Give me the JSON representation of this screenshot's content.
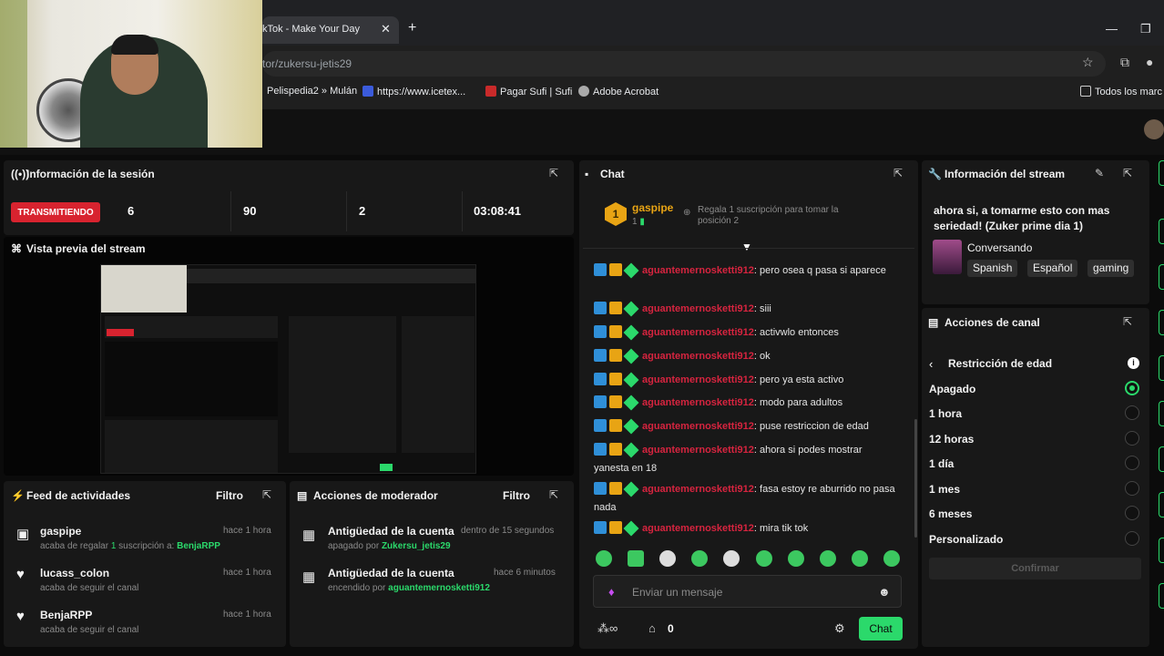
{
  "browser": {
    "tab_title": "kTok - Make Your Day",
    "tab_close": "✕",
    "new_tab": "+",
    "address": "tor/zukersu-jetis29",
    "bookmarks": [
      "Pelispedia2 » Mulán",
      "https://www.icetex...",
      "Pagar Sufi | Sufi",
      "Adobe Acrobat",
      "Todos los marc"
    ],
    "minimize": "—",
    "restore": "❐"
  },
  "session": {
    "title": "Información de la sesión",
    "status": "TRANSMITIENDO",
    "stats": [
      "6",
      "90",
      "2",
      "03:08:41"
    ]
  },
  "preview": {
    "title": "Vista previa del stream"
  },
  "feed": {
    "title": "Feed de actividades",
    "filter": "Filtro",
    "items": [
      {
        "name": "gaspipe",
        "time": "hace 1 hora",
        "sub_pre": "acaba de regalar ",
        "sub_count": "1",
        "sub_mid": " suscripción a: ",
        "sub_user": "BenjaRPP"
      },
      {
        "name": "lucass_colon",
        "time": "hace 1 hora",
        "sub": "acaba de seguir el canal"
      },
      {
        "name": "BenjaRPP",
        "time": "hace 1 hora",
        "sub": "acaba de seguir el canal"
      }
    ]
  },
  "mod": {
    "title": "Acciones de moderador",
    "filter": "Filtro",
    "items": [
      {
        "action": "Antigüedad de la cuenta",
        "time": "dentro de 15 segundos",
        "sub": "apagado por ",
        "user": "Zukersu_jetis29"
      },
      {
        "action": "Antigüedad de la cuenta",
        "time": "hace 6 minutos",
        "sub": "encendido por ",
        "user": "aguantemernosketti912"
      }
    ]
  },
  "chat": {
    "title": "Chat",
    "top_gifter": {
      "name": "gaspipe",
      "rank": "1",
      "count": "1",
      "note": "Regala 1 suscripción para tomar la posición 2"
    },
    "username": "aguantemernosketti912",
    "messages": [
      "pero osea q pasa si aparece",
      "siii",
      "activwlo entonces",
      "ok",
      "pero ya esta activo",
      "modo para adultos",
      "puse restriccion de edad",
      "ahora si podes mostrar yanesta en 18",
      "fasa estoy re aburrido no pasa nada",
      "mira tik tok"
    ],
    "input_placeholder": "Enviar un mensaje",
    "gifts_count": "0",
    "send_label": "Chat"
  },
  "stream_info": {
    "title": "Información del stream",
    "description": "ahora si, a tomarme esto con mas seriedad! (Zuker prime dia 1)",
    "category": "Conversando",
    "tags": [
      "Spanish",
      "Español",
      "gaming"
    ]
  },
  "channel_actions": {
    "title": "Acciones de canal",
    "subtitle": "Restricción de edad",
    "options": [
      "Apagado",
      "1 hora",
      "12 horas",
      "1 día",
      "1 mes",
      "6 meses",
      "Personalizado"
    ],
    "selected": "Apagado",
    "confirm": "Confirmar"
  },
  "colors": {
    "accent": "#2bd96b",
    "live": "#d8232f",
    "username": "#d6243f"
  }
}
